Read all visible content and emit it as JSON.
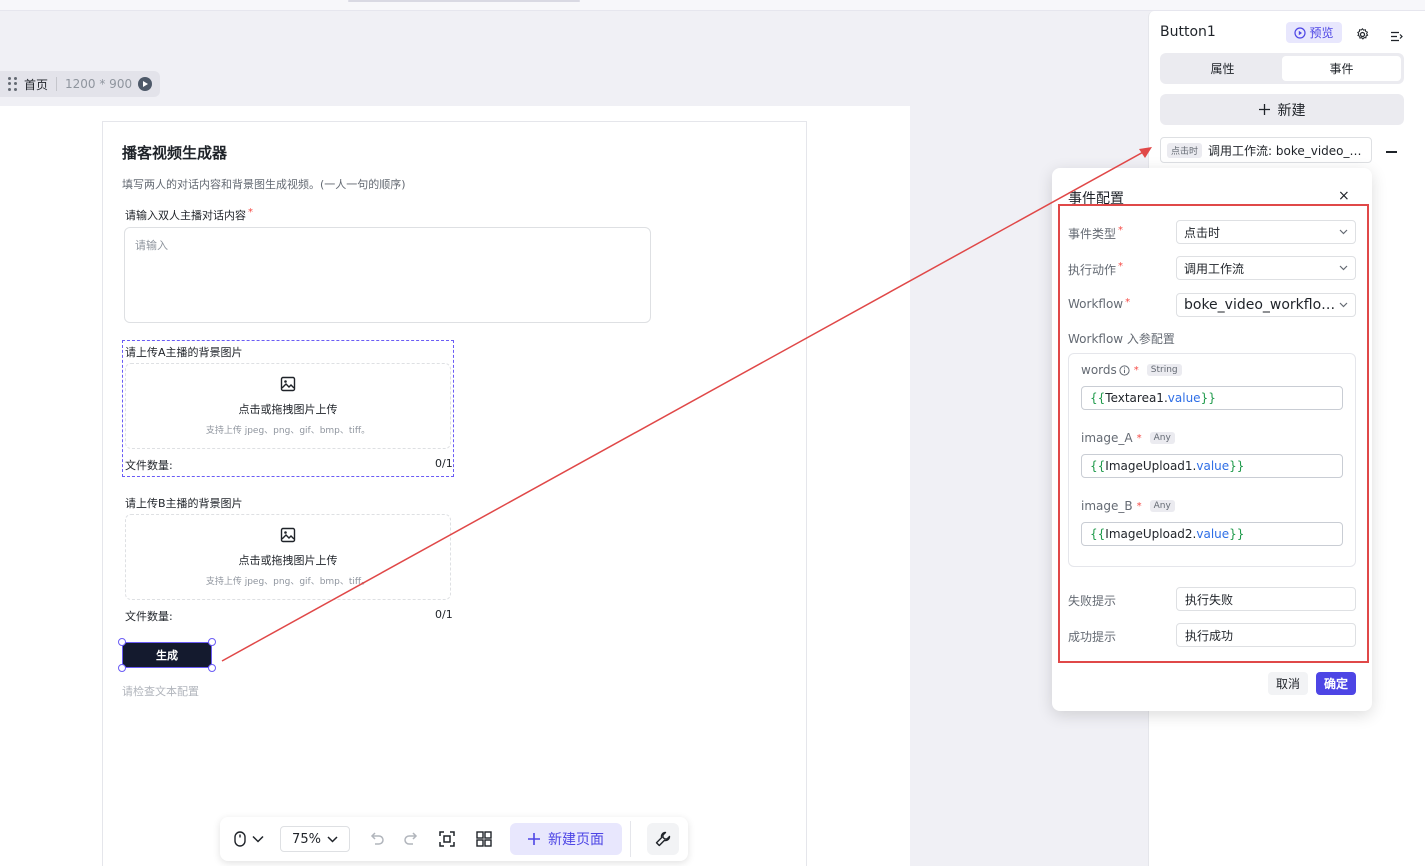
{
  "canvas": {
    "page_name": "首页",
    "page_size": "1200 * 900"
  },
  "form": {
    "title": "播客视频生成器",
    "description": "填写两人的对话内容和背景图生成视频。(一人一句的顺序)",
    "dialog_label": "请输入双人主播对话内容",
    "dialog_required": "*",
    "dialog_placeholder": "请输入",
    "upload_a": {
      "label": "请上传A主播的背景图片",
      "dropzone_text": "点击或拖拽图片上传",
      "dropzone_hint": "支持上传 jpeg、png、gif、bmp、tiff。",
      "count_label": "文件数量:",
      "count_value": "0/1"
    },
    "upload_b": {
      "label": "请上传B主播的背景图片",
      "dropzone_text": "点击或拖拽图片上传",
      "dropzone_hint": "支持上传 jpeg、png、gif、bmp、tiff。",
      "count_label": "文件数量:",
      "count_value": "0/1"
    },
    "generate_button": "生成",
    "hint_text": "请检查文本配置"
  },
  "toolbar": {
    "zoom": "75%",
    "new_page": "新建页面"
  },
  "panel": {
    "component_name": "Button1",
    "preview_label": "预览",
    "tabs": [
      "属性",
      "事件"
    ],
    "active_tab": "事件",
    "new_label": "新建",
    "event_item": {
      "tag": "点击时",
      "text": "调用工作流: boke_video_…"
    }
  },
  "popup": {
    "title": "事件配置",
    "close": "×",
    "event_type_label": "事件类型",
    "event_type_value": "点击时",
    "action_label": "执行动作",
    "action_value": "调用工作流",
    "workflow_label": "Workflow",
    "workflow_value": "boke_video_workflo…",
    "params_title": "Workflow 入参配置",
    "params": [
      {
        "name": "words",
        "type": "String",
        "ref": "Textarea1",
        "prop": "value"
      },
      {
        "name": "image_A",
        "type": "Any",
        "ref": "ImageUpload1",
        "prop": "value"
      },
      {
        "name": "image_B",
        "type": "Any",
        "ref": "ImageUpload2",
        "prop": "value"
      }
    ],
    "fail_label": "失败提示",
    "fail_value": "执行失败",
    "success_label": "成功提示",
    "success_value": "执行成功",
    "cancel_label": "取消",
    "ok_label": "确定"
  },
  "colors": {
    "accent": "#4d45e5",
    "annotation_red": "#e04848",
    "button_dark": "#141a2e"
  }
}
